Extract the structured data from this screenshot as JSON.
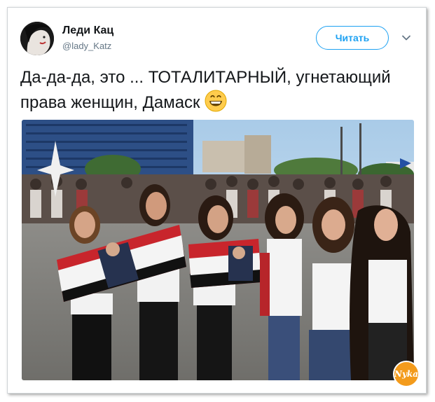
{
  "tweet": {
    "author_name": "Леди Кац",
    "author_handle": "@lady_Katz",
    "text": "Да-да-да, это ... ТОТАЛИТАРНЫЙ, угнетающий права женщин, Дамаск",
    "emoji_icon": "grinning-face-icon"
  },
  "actions": {
    "follow_label": "Читать",
    "menu_icon": "chevron-down-icon"
  },
  "photo": {
    "watermark_text": "Nyka"
  },
  "colors": {
    "accent": "#1da1f2",
    "text": "#14171a",
    "muted": "#657786",
    "watermark": "#f39b1c"
  }
}
